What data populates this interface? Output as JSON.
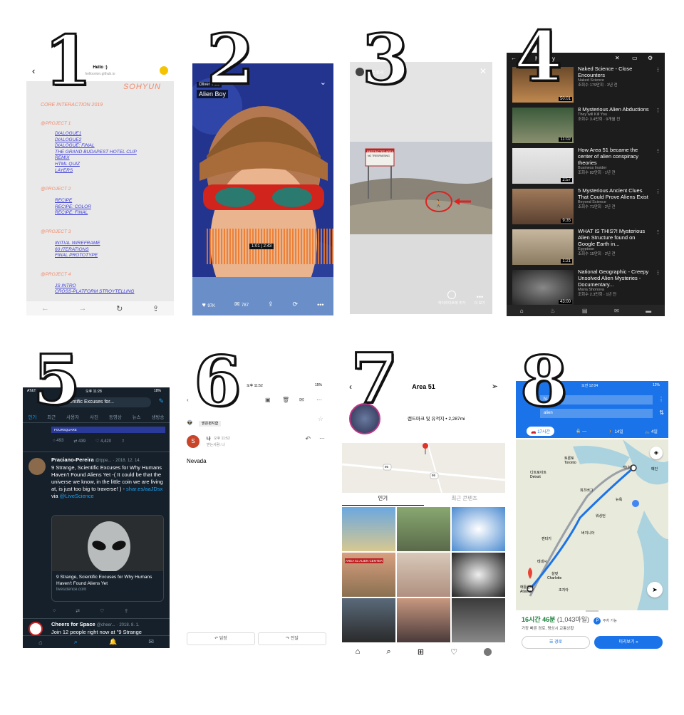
{
  "numbers": [
    "1",
    "2",
    "3",
    "4",
    "5",
    "6",
    "7",
    "8"
  ],
  "p1": {
    "title": "Hello :)",
    "url": "helloorion.github.io",
    "name": "SOHYUN",
    "course": "CORE INTERACTION 2019",
    "sections": [
      {
        "h": "@PROJECT 1",
        "items": [
          "DIALOGUE1",
          "DIALOGUE2",
          "DIALOGUE: FINAL",
          "THE GRAND BUDAPEST HOTEL CLIP",
          "REMIX",
          "HTML QUIZ",
          "LAYERS"
        ]
      },
      {
        "h": "@PROJECT 2",
        "items": [
          "RECIPE",
          "RECIPE: COLOR",
          "RECIPE: FINAL"
        ]
      },
      {
        "h": "@PROJECT 3",
        "items": [
          "INITIAL WIREFRAME",
          "60 ITERATIONS",
          "FINAL PROTOTYPE"
        ]
      },
      {
        "h": "@PROJECT 4",
        "items": [
          "JS INTRO",
          "CROSS-PLATFORM STROYTELLING"
        ]
      }
    ]
  },
  "p2": {
    "artist": "Oliver Tree",
    "track": "Alien Boy",
    "time": "1:01 | 2:43",
    "likes": "97K",
    "comments": "787"
  },
  "p3": {
    "user": "내 스토리",
    "sign1": "RESTRICTED AREA",
    "sign2": "NO TRESPASSING",
    "action1": "하이라이트에 추가",
    "action2": "더 보기"
  },
  "p4": {
    "header": "Mystery",
    "videos": [
      {
        "title": "Naked Science - Close Encounters",
        "channel": "Naked Science",
        "meta": "조회수 179만회 · 3년 전",
        "dur": "50:01"
      },
      {
        "title": "8 Mysterious Alien Abductions",
        "channel": "They will Kill You",
        "meta": "조회수 3.4만회 · 9개월 전",
        "dur": "11:02"
      },
      {
        "title": "How Area 51 became the center of alien conspiracy theories",
        "channel": "Business Insider",
        "meta": "조회수 82만회 · 1년 전",
        "dur": "2:57"
      },
      {
        "title": "5 Mysterious Ancient Clues That Could Prove Aliens Exist",
        "channel": "Beyond Science",
        "meta": "조회수 71만회 · 2년 전",
        "dur": "9:35"
      },
      {
        "title": "WHAT IS THIS?! Mysterious Alien Structure found on Google Earth in...",
        "channel": "Egyptoon",
        "meta": "조회수 15만회 · 2년 전",
        "dur": "1:21"
      },
      {
        "title": "National Geographic - Creepy Unsolved Alien Mysteries - Documentary...",
        "channel": "Maria Shonova",
        "meta": "조회수 2.3만회 · 1년 전",
        "dur": "43:00"
      }
    ]
  },
  "p5": {
    "carrier": "AT&T",
    "time": "오후 11:28",
    "battery": "18%",
    "search": "Scientific Excuses for...",
    "tabs": [
      "인기",
      "최근",
      "사용자",
      "사진",
      "동영상",
      "뉴스",
      "생방송"
    ],
    "banner": "FOURSQUARE",
    "stats": [
      "493",
      "439",
      "4,420"
    ],
    "tweet1": {
      "user": "Praciano-Pereira",
      "handle": "@tppe...",
      "date": "· 2018. 12. 14.",
      "text": "9 Strange, Scientific Excuses for Why Humans Haven't Found Aliens Yet -( It could be that the universe we know, in the little coin we are living at, is just too big to traverse! ) - ",
      "link": "shar.es/aaJDsx",
      "via": " via ",
      "mention": "@LiveScience"
    },
    "card_title": "9 Strange, Scientific Excuses for Why Humans Haven't Found Aliens Yet",
    "card_domain": "livescience.com",
    "tweet2": {
      "user": "Cheers for Space",
      "handle": "@cheer...",
      "date": "· 2018. 8. 1.",
      "text": "Join 12 people right now at \"9 Strange"
    }
  },
  "p6": {
    "time": "오후 11:52",
    "battery": "15%",
    "label": "받은편지함",
    "sender": "나",
    "sender_time": "오후 11:52",
    "to": "받는사람: 나",
    "avatar": "S",
    "body": "Nevada",
    "reply": "답장",
    "forward": "전달"
  },
  "p7": {
    "title": "Area 51",
    "info": "랜드마크 및 유적지 • 2,287mi",
    "road1": "95",
    "road2": "95",
    "tab1": "인기",
    "tab2": "최근 콘텐츠",
    "sign": "AREA 51 ALIEN CENTER"
  },
  "p8": {
    "time": "오전 12:04",
    "battery": "12%",
    "from": "N...",
    "to": "alien",
    "modes": [
      "17시간",
      "—",
      "14일",
      "4일"
    ],
    "duration": "16시간 46분",
    "distance": "(1,043마일)",
    "parking": "주차 가능",
    "note": "가장 빠른 경로, 평상시 교통상황",
    "btn1": "경로",
    "btn2": "미리보기",
    "cities": [
      "토론토",
      "Toronto",
      "디트로이트",
      "Detroit",
      "뉴욕",
      "피츠버그",
      "워싱턴",
      "샬럿",
      "Charlotte",
      "애틀랜타",
      "Atlanta",
      "테네시",
      "켄터키",
      "캐나다",
      "메인",
      "버지니아",
      "조지아"
    ]
  }
}
